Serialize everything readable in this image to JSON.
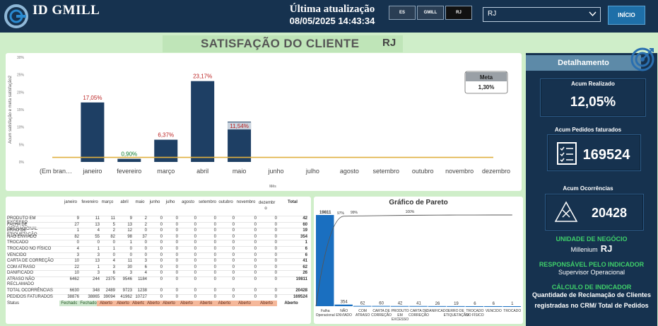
{
  "header": {
    "brand": "ID GMILL",
    "update_label": "Última atualização",
    "update_date": "08/05/2025 14:43:34",
    "filters": [
      "ES",
      "GMILL",
      "RJ"
    ],
    "state_value": "RJ",
    "home_label": "INÍCIO"
  },
  "page": {
    "title": "SATISFAÇÃO DO CLIENTE",
    "state": "RJ"
  },
  "colors": {
    "navy": "#16324f",
    "bar": "#1e3f64",
    "meta_line": "#e0b040",
    "green_text": "#3fd06a",
    "pareto_bar": "#1a6fc0",
    "status_fechado": "#cfe8cf",
    "status_aberto": "#f5b89a"
  },
  "chart_data": [
    {
      "type": "bar",
      "title": "",
      "xlabel": "Mês",
      "ylabel": "Acum satisfação e meta satisfação2",
      "ylim": [
        0,
        30
      ],
      "yticks": [
        "0%",
        "5%",
        "10%",
        "15%",
        "20%",
        "25%",
        "30%"
      ],
      "categories": [
        "(Em bran…",
        "janeiro",
        "fevereiro",
        "março",
        "abril",
        "maio",
        "junho",
        "julho",
        "agosto",
        "setembro",
        "outubro",
        "novembro",
        "dezembro"
      ],
      "values": [
        null,
        17.05,
        0.9,
        6.37,
        23.17,
        11.54,
        null,
        null,
        null,
        null,
        null,
        null,
        null
      ],
      "labels": [
        "",
        "17,05%",
        "0,90%",
        "6,37%",
        "23,17%",
        "11,54%",
        "",
        "",
        "",
        "",
        "",
        "",
        ""
      ],
      "meta": 1.3,
      "meta_label": "Meta",
      "meta_value": "1,30%",
      "grid": false,
      "legend": "top-right"
    },
    {
      "type": "bar",
      "title": "Gráfico de Pareto",
      "categories": [
        "Falha Operacional",
        "NÃO ENVIADO",
        "COM ATRASO",
        "CARTA DE CORREÇÃO",
        "PRODUTO EM EXCESSO",
        "CARTA DE CORREÇÃO",
        "DANIFICADO",
        "ERRO DE ETIQUETAÇÃO",
        "TROCADO NO FÍSICO",
        "VENCIDO",
        "TROCADO"
      ],
      "values": [
        19811,
        354,
        62,
        60,
        42,
        41,
        26,
        19,
        6,
        6,
        1
      ],
      "value_labels": [
        "19811",
        "354",
        "62",
        "60",
        "42",
        "41",
        "26",
        "19",
        "6",
        "6",
        "1"
      ],
      "cumulative_labels": [
        "97%",
        "99%",
        "100%"
      ],
      "grid": false
    }
  ],
  "table": {
    "columns": [
      "janeiro",
      "fevereiro",
      "março",
      "abril",
      "maio",
      "junho",
      "julho",
      "agosto",
      "setembro",
      "outubro",
      "novembro",
      "dezembro",
      "Total"
    ],
    "rows": [
      {
        "name": "PRODUTO EM EXCESSO",
        "values": [
          "9",
          "11",
          "11",
          "9",
          "2",
          "0",
          "0",
          "0",
          "0",
          "0",
          "0",
          "0",
          "42"
        ]
      },
      {
        "name": "FALHA DE OPERACIONAL",
        "values": [
          "27",
          "13",
          "5",
          "13",
          "2",
          "0",
          "0",
          "0",
          "0",
          "0",
          "0",
          "0",
          "60"
        ]
      },
      {
        "name": "ERRO DE ETIQUETAÇÃO",
        "values": [
          "1",
          "4",
          "2",
          "12",
          "0",
          "0",
          "0",
          "0",
          "0",
          "0",
          "0",
          "0",
          "19"
        ]
      },
      {
        "name": "NÃO ENVIADO",
        "values": [
          "82",
          "55",
          "82",
          "98",
          "37",
          "0",
          "0",
          "0",
          "0",
          "0",
          "0",
          "0",
          "354"
        ]
      },
      {
        "name": "TROCADO",
        "values": [
          "0",
          "0",
          "0",
          "1",
          "0",
          "0",
          "0",
          "0",
          "0",
          "0",
          "0",
          "0",
          "1"
        ]
      },
      {
        "name": "TROCADO NO FÍSICO",
        "values": [
          "4",
          "1",
          "1",
          "0",
          "0",
          "0",
          "0",
          "0",
          "0",
          "0",
          "0",
          "0",
          "6"
        ]
      },
      {
        "name": "VENCIDO",
        "values": [
          "3",
          "3",
          "0",
          "0",
          "0",
          "0",
          "0",
          "0",
          "0",
          "0",
          "0",
          "0",
          "6"
        ]
      },
      {
        "name": "CARTA DE CORREÇÃO",
        "values": [
          "10",
          "13",
          "4",
          "11",
          "3",
          "0",
          "0",
          "0",
          "0",
          "0",
          "0",
          "0",
          "41"
        ]
      },
      {
        "name": "COM ATRASO",
        "values": [
          "22",
          "1",
          "3",
          "30",
          "6",
          "0",
          "0",
          "0",
          "0",
          "0",
          "0",
          "0",
          "62"
        ]
      },
      {
        "name": "DANIFICADO",
        "values": [
          "10",
          "3",
          "6",
          "3",
          "4",
          "0",
          "0",
          "0",
          "0",
          "0",
          "0",
          "0",
          "26"
        ]
      },
      {
        "name": "ATRASO NÃO RECLAMADO",
        "values": [
          "6462",
          "244",
          "2375",
          "9546",
          "1184",
          "0",
          "0",
          "0",
          "0",
          "0",
          "0",
          "0",
          "19811"
        ]
      },
      {
        "name": "TOTAL OCORRÊNCIAS",
        "values": [
          "6630",
          "348",
          "2489",
          "9723",
          "1238",
          "0",
          "0",
          "0",
          "0",
          "0",
          "0",
          "0",
          "20428"
        ]
      },
      {
        "name": "PEDIDOS FATURADOS",
        "values": [
          "38876",
          "38865",
          "39094",
          "41962",
          "10727",
          "0",
          "0",
          "0",
          "0",
          "0",
          "0",
          "0",
          "169524"
        ]
      }
    ],
    "status_label": "Status",
    "status": [
      "Fechado",
      "Fechado",
      "Aberto",
      "Aberto",
      "Aberto",
      "Aberto",
      "Aberto",
      "Aberto",
      "Aberto",
      "Aberto",
      "Aberto",
      "Aberto",
      "Aberto"
    ]
  },
  "sidebar": {
    "title": "Detalhamento",
    "kpi_realizado_label": "Acum Realizado",
    "kpi_realizado_value": "12,05%",
    "kpi_pedidos_label": "Acum Pedidos faturados",
    "kpi_pedidos_value": "169524",
    "kpi_ocorrencias_label": "Acum Ocorrências",
    "kpi_ocorrencias_value": "20428",
    "unidade_label": "UNIDADE DE NEGÓCIO",
    "unidade_value": "Millenium",
    "unidade_state": "RJ",
    "responsavel_label": "RESPONSÁVEL PELO INDICADOR",
    "responsavel_value": "Supervisor Operacional",
    "calculo_label": "CÁLCULO DE INDICADOR",
    "calculo_value": "Quantidade de Reclamação de Clientes registradas no CRM/ Total de Pedidos"
  }
}
